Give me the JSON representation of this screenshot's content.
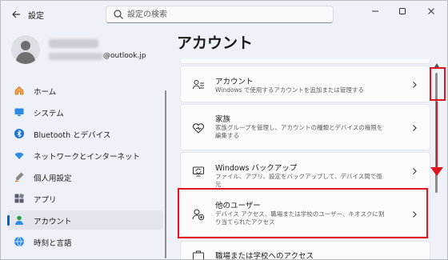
{
  "window": {
    "app_title": "設定",
    "controls": {
      "minimize": "minimize-icon",
      "maximize": "maximize-icon",
      "close": "close-icon"
    }
  },
  "search": {
    "placeholder": "設定の検索",
    "value": ""
  },
  "user": {
    "email_suffix": "@outlook.jp"
  },
  "sidebar": {
    "items": [
      {
        "label": "ホーム",
        "icon": "home-icon"
      },
      {
        "label": "システム",
        "icon": "system-icon"
      },
      {
        "label": "Bluetooth とデバイス",
        "icon": "bluetooth-icon"
      },
      {
        "label": "ネットワークとインターネット",
        "icon": "wifi-icon"
      },
      {
        "label": "個人用設定",
        "icon": "brush-icon"
      },
      {
        "label": "アプリ",
        "icon": "apps-icon"
      },
      {
        "label": "アカウント",
        "icon": "account-icon",
        "selected": true
      },
      {
        "label": "時刻と言語",
        "icon": "globe-icon"
      }
    ]
  },
  "main": {
    "title": "アカウント",
    "cards": [
      {
        "title": "アカウント",
        "description": "Windows で使用するアカウントを追加または管理する",
        "icon": "accounts-icon"
      },
      {
        "title": "家族",
        "description": "家族グループを管理し、アカウントの種類とデバイスの権限を編集する",
        "icon": "family-icon"
      },
      {
        "title": "Windows バックアップ",
        "description": "ファイル、アプリ、設定をバックアップして、デバイス間で復元",
        "icon": "backup-icon"
      },
      {
        "title": "他のユーザー",
        "description": "デバイス アクセス、職場または学校のユーザー、キオスクに割り当てられたアクセス",
        "icon": "add-user-icon",
        "highlighted": true
      },
      {
        "title": "職場または学校へのアクセス",
        "description": "",
        "icon": "briefcase-icon"
      }
    ]
  },
  "colors": {
    "accent": "#0067c0",
    "highlight": "#e3141f",
    "background": "#eef1f7",
    "card": "#fbfbfb"
  }
}
